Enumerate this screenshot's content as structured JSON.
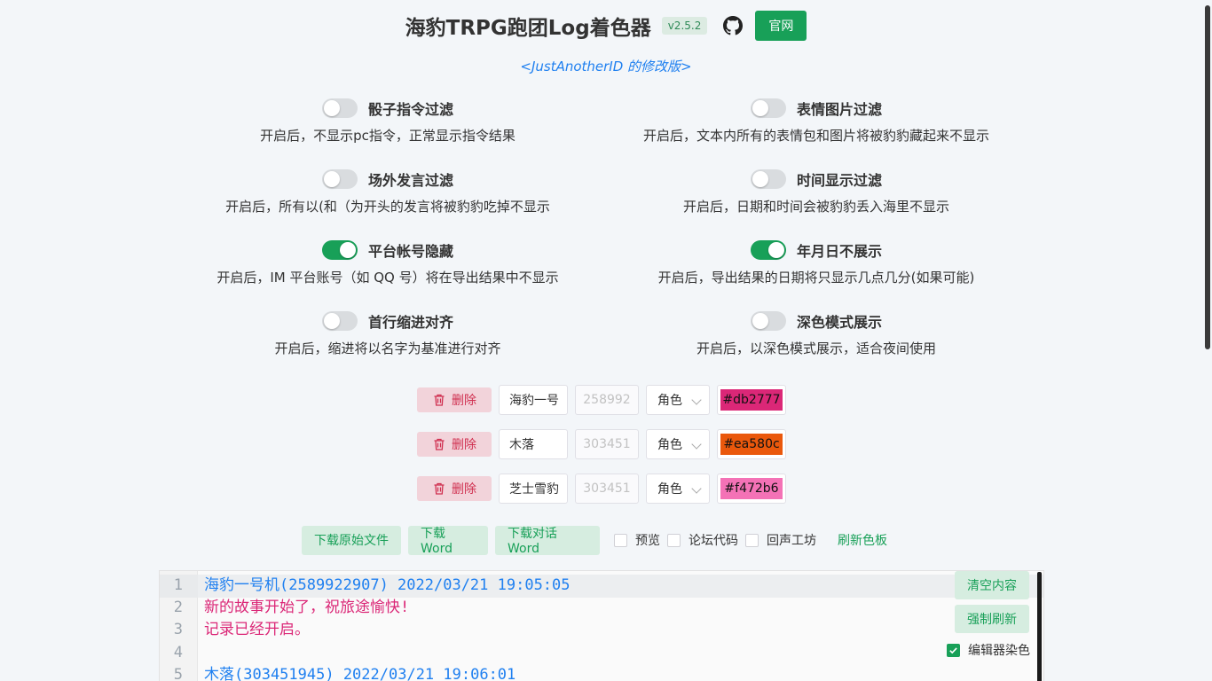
{
  "header": {
    "title": "海豹TRPG跑团Log着色器",
    "version": "v2.5.2",
    "site_button": "官网",
    "subtitle": "<JustAnotherID 的修改版>"
  },
  "options": [
    {
      "title": "骰子指令过滤",
      "desc": "开启后，不显示pc指令，正常显示指令结果",
      "on": false
    },
    {
      "title": "表情图片过滤",
      "desc": "开启后，文本内所有的表情包和图片将被豹豹藏起来不显示",
      "on": false
    },
    {
      "title": "场外发言过滤",
      "desc": "开启后，所有以(和（为开头的发言将被豹豹吃掉不显示",
      "on": false
    },
    {
      "title": "时间显示过滤",
      "desc": "开启后，日期和时间会被豹豹丢入海里不显示",
      "on": false
    },
    {
      "title": "平台帐号隐藏",
      "desc": "开启后，IM 平台账号（如 QQ 号）将在导出结果中不显示",
      "on": true
    },
    {
      "title": "年月日不展示",
      "desc": "开启后，导出结果的日期将只显示几点几分(如果可能)",
      "on": true
    },
    {
      "title": "首行缩进对齐",
      "desc": "开启后，缩进将以名字为基准进行对齐",
      "on": false
    },
    {
      "title": "深色模式展示",
      "desc": "开启后，以深色模式展示，适合夜间使用",
      "on": false
    }
  ],
  "characters": [
    {
      "delete_label": "删除",
      "name": "海豹一号",
      "id": "258992",
      "role": "角色",
      "color": "#db2777"
    },
    {
      "delete_label": "删除",
      "name": "木落",
      "id": "303451",
      "role": "角色",
      "color": "#ea580c"
    },
    {
      "delete_label": "删除",
      "name": "芝士雪豹",
      "id": "303451",
      "role": "角色",
      "color": "#f472b6"
    }
  ],
  "actions": {
    "download_raw": "下载原始文件",
    "download_word": "下载Word",
    "download_dialog_word": "下载对话Word",
    "preview": "预览",
    "forum_code": "论坛代码",
    "echo_workshop": "回声工坊",
    "refresh_palette": "刷新色板"
  },
  "editor": {
    "clear_button": "清空内容",
    "force_refresh_button": "强制刷新",
    "editor_color_label": "编辑器染色",
    "lines": [
      {
        "num": "1",
        "text": "海豹一号机(2589922907) 2022/03/21 19:05:05",
        "color": "#2080f0"
      },
      {
        "num": "2",
        "text": "新的故事开始了，祝旅途愉快!",
        "color": "#db2777"
      },
      {
        "num": "3",
        "text": "记录已经开启。",
        "color": "#db2777"
      },
      {
        "num": "4",
        "text": "",
        "color": "#333333"
      },
      {
        "num": "5",
        "text": "木落(303451945) 2022/03/21 19:06:01",
        "color": "#2080f0"
      }
    ]
  },
  "icons": {
    "github": "github-icon",
    "delete": "trash-icon",
    "dropdown": "chevron-down-icon",
    "check": "check-icon"
  },
  "colors": {
    "accent": "#18a058",
    "danger": "#d03050",
    "link": "#2080f0"
  }
}
